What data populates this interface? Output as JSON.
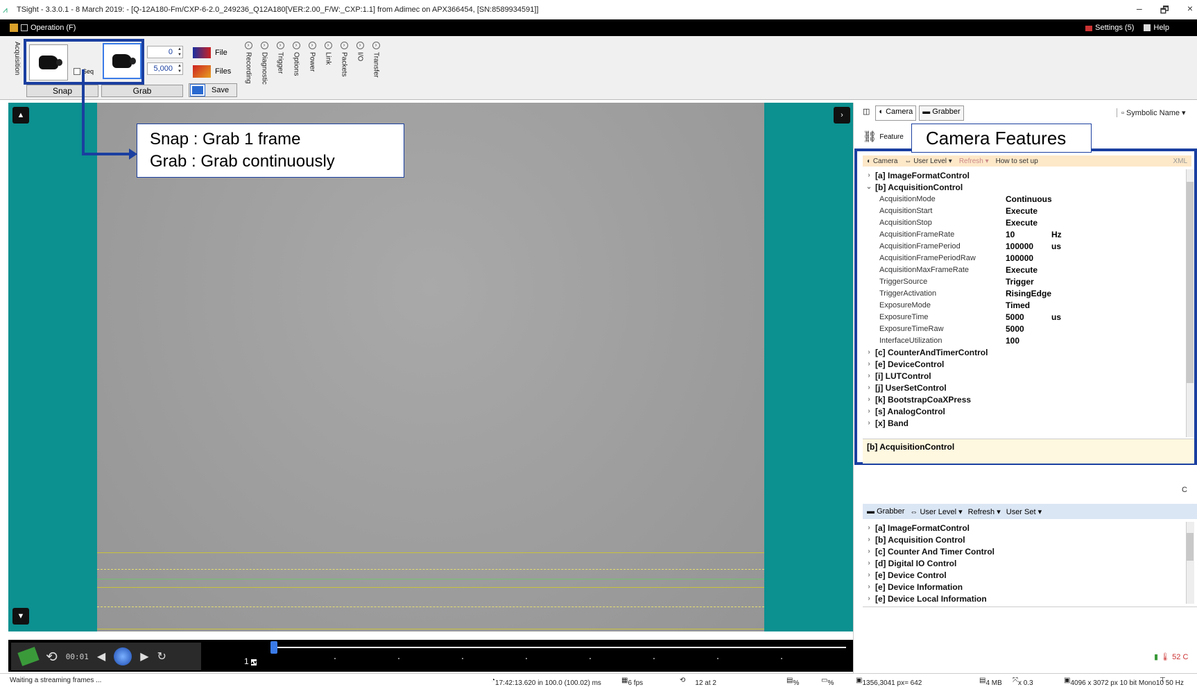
{
  "window": {
    "title": "TSight - 3.3.0.1 - 8 March 2019:  - [Q-12A180-Fm/CXP-6-2.0_249236_Q12A180[VER:2.00_F/W:_CXP:1.1] from Adimec on APX366454, [SN:8589934591]]",
    "minimize": "–",
    "restore": "🗗",
    "close": "×"
  },
  "menubar": {
    "operation": "Operation (F)",
    "settings": "Settings (5)",
    "help": "Help"
  },
  "toolbar": {
    "acquisition_tab": "Acquisition",
    "seq_label": "Seq",
    "snap_label": "Snap",
    "grab_label": "Grab",
    "count_value": "0",
    "period_value": "5,000",
    "file_label": "File",
    "files_label": "Files",
    "save_label": "Save",
    "side_tabs": [
      "Recording",
      "Diagnostic",
      "Trigger",
      "Options",
      "Power",
      "Link",
      "Packets",
      "I/O",
      "Transfer"
    ]
  },
  "callouts": {
    "snap_grab_line1": "Snap : Grab 1 frame",
    "snap_grab_line2": "Grab : Grab continuously",
    "camera_features": "Camera Features"
  },
  "playback": {
    "time": "00:01",
    "frame_index": "1"
  },
  "right_panel": {
    "tab_camera": "Camera",
    "tab_grabber": "Grabber",
    "symbolic_name": "Symbolic Name",
    "features_tab": "Feature",
    "camera_header": {
      "camera": "Camera",
      "user_level": "User Level",
      "refresh": "Refresh",
      "how_to": "How to set up",
      "xml": "XML"
    },
    "groups_top": [
      "[a] ImageFormatControl",
      "[b] AcquisitionControl"
    ],
    "features": [
      {
        "name": "AcquisitionMode",
        "value": "Continuous",
        "unit": ""
      },
      {
        "name": "AcquisitionStart",
        "value": "Execute",
        "unit": ""
      },
      {
        "name": "AcquisitionStop",
        "value": "Execute",
        "unit": ""
      },
      {
        "name": "AcquisitionFrameRate",
        "value": "10",
        "unit": "Hz"
      },
      {
        "name": "AcquisitionFramePeriod",
        "value": "100000",
        "unit": "us"
      },
      {
        "name": "AcquisitionFramePeriodRaw",
        "value": "100000",
        "unit": ""
      },
      {
        "name": "AcquisitionMaxFrameRate",
        "value": "Execute",
        "unit": ""
      },
      {
        "name": "TriggerSource",
        "value": "Trigger",
        "unit": ""
      },
      {
        "name": "TriggerActivation",
        "value": "RisingEdge",
        "unit": ""
      },
      {
        "name": "ExposureMode",
        "value": "Timed",
        "unit": ""
      },
      {
        "name": "ExposureTime",
        "value": "5000",
        "unit": "us"
      },
      {
        "name": "ExposureTimeRaw",
        "value": "5000",
        "unit": ""
      },
      {
        "name": "InterfaceUtilization",
        "value": "100",
        "unit": ""
      }
    ],
    "groups_bottom": [
      "[c] CounterAndTimerControl",
      "[e] DeviceControl",
      "[i] LUTControl",
      "[j] UserSetControl",
      "[k] BootstrapCoaXPress",
      "[s] AnalogControl",
      "[x] Band"
    ],
    "description": "[b] AcquisitionControl",
    "c_label": "C",
    "grabber_header": {
      "grabber": "Grabber",
      "user_level": "User Level",
      "refresh": "Refresh",
      "user_set": "User Set"
    },
    "grabber_groups": [
      "[a] ImageFormatControl",
      "[b] Acquisition Control",
      "[c] Counter And Timer Control",
      "[d] Digital IO Control",
      "[e] Device Control",
      "[e] Device Information",
      "[e] Device Local Information"
    ],
    "temperature": "52 C"
  },
  "status": {
    "message": "Waiting a streaming frames ...",
    "timestamp": "17:42:13.620 in 100.0 (100.02) ms",
    "fps": "6 fps",
    "frames": "12 at  2",
    "percent": "%",
    "percent2": "%",
    "pixel": "1356,3041 px= 642",
    "memory": "4 MB",
    "zoom": "x 0.3",
    "format": "4096 x 3072 px 10 bit Mono10",
    "rate": "50 Hz"
  },
  "colors": {
    "viewer_bg": "#0c9090",
    "highlight": "#1a3fa0",
    "overlay_yellow": "#c9c23a",
    "overlay_green": "#5fd35f"
  }
}
